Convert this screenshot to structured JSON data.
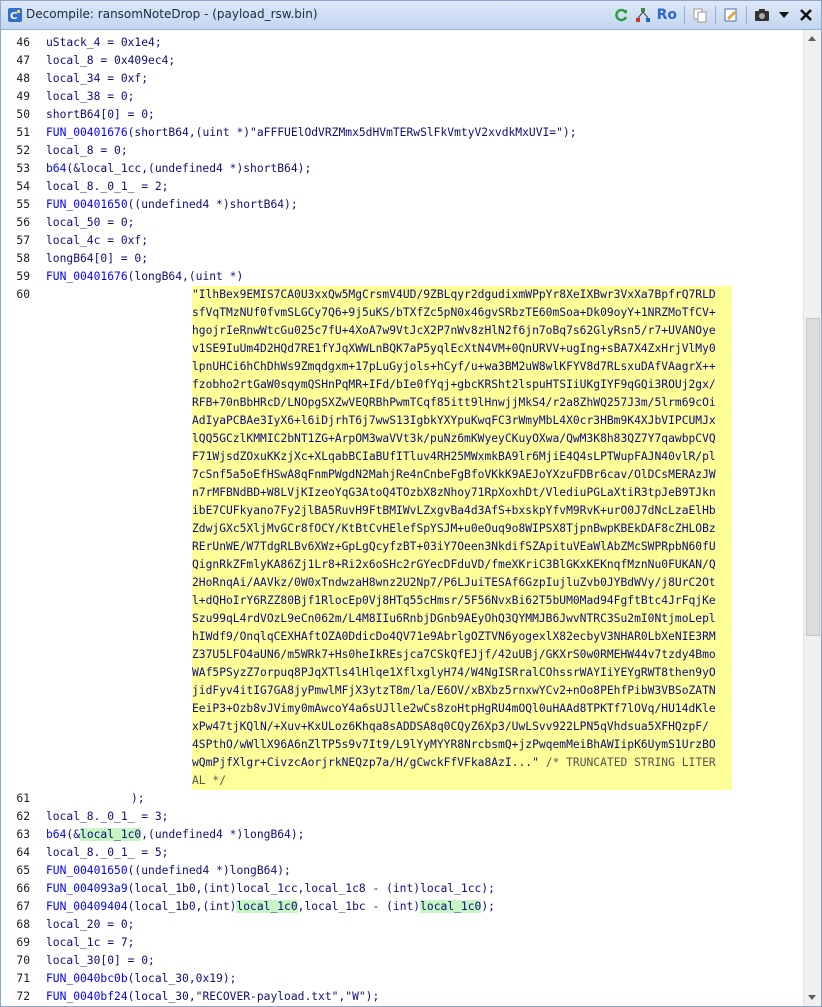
{
  "window": {
    "title": "Decompile: ransomNoteDrop - (payload_rsw.bin)",
    "toolbar": {
      "icons": [
        "refresh-icon",
        "call-graph-icon",
        "read-only-label",
        "copy-icon",
        "edit-icon",
        "snapshot-icon",
        "dropdown-menu-icon",
        "close-icon"
      ],
      "ro_label": "Ro"
    }
  },
  "code": {
    "l46": {
      "n": "46",
      "t": "uStack_4 = 0x1e4;"
    },
    "l47": {
      "n": "47",
      "t": "local_8 = 0x409ec4;"
    },
    "l48": {
      "n": "48",
      "t": "local_34 = 0xf;"
    },
    "l49": {
      "n": "49",
      "t": "local_38 = 0;"
    },
    "l50": {
      "n": "50",
      "t": "shortB64[0] = 0;"
    },
    "l51": {
      "n": "51",
      "fn": "FUN_00401676",
      "a": "(shortB64,(uint *)\"aFFFUElOdVRZMmx5dHVmTERwSlFkVmtyV2xvdkMxUVI=\");"
    },
    "l52": {
      "n": "52",
      "t": "local_8 = 0;"
    },
    "l53": {
      "n": "53",
      "fn": "b64",
      "a": "(&local_1cc,(undefined4 *)shortB64);"
    },
    "l54": {
      "n": "54",
      "t": "local_8._0_1_ = 2;"
    },
    "l55": {
      "n": "55",
      "fn": "FUN_00401650",
      "a": "((undefined4 *)shortB64);"
    },
    "l56": {
      "n": "56",
      "t": "local_50 = 0;"
    },
    "l57": {
      "n": "57",
      "t": "local_4c = 0xf;"
    },
    "l58": {
      "n": "58",
      "t": "longB64[0] = 0;"
    },
    "l59": {
      "n": "59",
      "fn": "FUN_00401676",
      "a": "(longB64,(uint *)"
    },
    "l60": {
      "n": "60"
    },
    "long_string_lines": [
      "\"IlhBex9EMIS7CA0U3xxQw5MgCrsmV4UD/9ZBLqyr2dgudixmWPpYr8XeIXBwr3VxXa7BpfrQ7RLD",
      "sfVqTMzNUf0fvmSLGCy7Q6+9j5uKS/bTXfZc5pN0x46gvSRbzTE60mSoa+Dk09oyY+1NRZMoTfCV+",
      "hgojrIeRnwWtcGu025c7fU+4XoA7w9VtJcX2P7nWv8zHlN2f6jn7oBq7s62GlyRsn5/r7+UVANOye",
      "v1SE9IuUm4D2HQd7RE1fYJqXWWLnBQK7aP5yqlEcXtN4VM+0QnURVV+ugIng+sBA7X4ZxHrjVlMy0",
      "lpnUHCi6hChDhWs9Zmqdgxm+17pLuGyjols+hCyf/u+wa3BM2uW8wlKFYV8d7RLsxuDAfVAagrX++",
      "fzobho2rtGaW0sqymQSHnPqMR+IFd/bIe0fYqj+gbcKRSht2lspuHTSIiUKgIYF9qGQi3ROUj2gx/",
      "RFB+70nBbHRcD/LNOpgSXZwVEQRBhPwmTCqf85itt9lHnwjjMkS4/r2a8ZhWQ257J3m/5lrm69cOi",
      "AdIyaPCBAe3IyX6+l6iDjrhT6j7wwS13IgbkYXYpuKwqFC3rWmyMbL4X0cr3HBm9K4XJbVIPCUMJx",
      "lQQ5GCzlKMMIC2bNT1ZG+ArpOM3waVVt3k/puNz6mKWyeyCKuyOXwa/QwM3K8h83QZ7Y7qawbpCVQ",
      "F71WjsdZOxuKKzjXc+XLqabBCIaBUfITluv4RH25MWxmkBA9lr6MjiE4Q4sLPTWupFAJN40vlR/pl",
      "7cSnf5a5oEfHSwA8qFnmPWgdN2MahjRe4nCnbeFgBfoVKkK9AEJoYXzuFDBr6cav/OlDCsMERAzJW",
      "n7rMFBNdBD+W8LVjKIzeoYqG3AtoQ4TOzbX8zNhoy71RpXoxhDt/VlediuPGLaXtiR3tpJeB9TJkn",
      "ibE7CUFkyano7Fy2jlBA5RuvH9FtBMIWvLZxgvBa4d3AfS+bxskpYfvM9RvK+urO0J7dNcLzaElHb",
      "ZdwjGXc5XljMvGCr8fOCY/KtBtCvHElefSpYSJM+u0eOuq9o8WIPSX8TjpnBwpKBEkDAF8cZHLOBz",
      "RErUnWE/W7TdgRLBv6XWz+GpLgQcyfzBT+03iY7Oeen3NkdifSZApituVEaWlAbZMcSWPRpbN60fU",
      "QignRkZFmlyKA86Zj1Lr8+Ri2x6oSHc2rGYecDFduVD/fmeXKriC3BlGKxKEKnqfMznNu0FUKAN/Q",
      "2HoRnqAi/AAVkz/0W0xTndwzaH8wnz2U2Np7/P6LJuiTESAf6GzpIujluZvb0JYBdWVy/j8UrC2Ot",
      "l+dQHoIrY6RZZ80Bjf1RlocEp0Vj8HTq55cHmsr/5F56NvxBi62T5bUM0Mad94FgftBtc4JrFqjKe",
      "Szu99qL4rdVOzL9eCn062m/L4M8IIu6RnbjDGnb9AEyOhQ3QYMMJB6JwvNTRC3Su2mI0NtjmoLepl",
      "hIWdf9/OnqlqCEXHAftOZA0DdicDo4QV71e9AbrlgOZTVN6yogexlX82ecbyV3NHAR0LbXeNIE3RM",
      "Z37U5LFO4aUN6/m5WRk7+Hs0heIkREsjca7CSkQfEJjf/42uUBj/GKXrS0w0RMEHW44v7tzdy4Bmo",
      "WAf5PSyzZ7orpuq8PJqXTls4lHlqe1XflxglyH74/W4NgISRralCOhssrWAYIiYEYgRWT8then9yO",
      "jidFyv4itIG7GA8jyPmwlMFjX3ytzT8m/la/E6OV/xBXbz5rnxwYCv2+nOo8PEhfPibW3VBSoZATN",
      "EeiP3+Ozb8vJVimy0mAwcoY4a6sUJlle2wCs8zoHtpHgRU4mOQl0uHAAd8TPKTf7lOVq/HU14dKle",
      "xPw47tjKQlN/+Xuv+KxULoz6Khqa8sADDSA8q0CQyZ6Xp3/UwLSvv922LPN5qVhdsua5XFHQzpF/",
      "4SPthO/wWllX96A6nZlTP5s9v7It9/L9lYyMYYR8NrcbsmQ+jzPwqemMeiBhAWIipK6UymS1UrzBO",
      "wQmPjfXlgr+CivzcAorjrkNEQzp7a/H/gCwckFfVFka8AzI...\""
    ],
    "long_string_comment_a": "/* TRUNCATED STRING LITER",
    "long_string_comment_b": "AL */",
    "l61": {
      "n": "61",
      "t": ");"
    },
    "l62": {
      "n": "62",
      "t": "local_8._0_1_ = 3;"
    },
    "l63": {
      "n": "63",
      "fn": "b64",
      "a1": "(&",
      "hl": "local_1c0",
      "a2": ",(undefined4 *)longB64);"
    },
    "l64": {
      "n": "64",
      "t": "local_8._0_1_ = 5;"
    },
    "l65": {
      "n": "65",
      "fn": "FUN_00401650",
      "a": "((undefined4 *)longB64);"
    },
    "l66": {
      "n": "66",
      "fn": "FUN_004093a9",
      "a": "(local_1b0,(int)local_1cc,local_1c8 - (int)local_1cc);"
    },
    "l67": {
      "n": "67",
      "fn": "FUN_00409404",
      "a1": "(local_1b0,(int)",
      "hl1": "local_1c0",
      "a2": ",local_1bc - (int)",
      "hl2": "local_1c0",
      "a3": ");"
    },
    "l68": {
      "n": "68",
      "t": "local_20 = 0;"
    },
    "l69": {
      "n": "69",
      "t": "local_1c = 7;"
    },
    "l70": {
      "n": "70",
      "t": "local_30[0] = 0;"
    },
    "l71": {
      "n": "71",
      "fn": "FUN_0040bc0b",
      "a": "(local_30,0x19);"
    },
    "l72": {
      "n": "72",
      "fn": "FUN_0040bf24",
      "a": "(local_30,\"RECOVER-payload.txt\",\"W\");"
    }
  },
  "colors": {
    "function": "#0000ff",
    "code_text": "#0d0d7a",
    "string_highlight": "#ffff99",
    "variable_highlight": "#c7f5c4"
  }
}
